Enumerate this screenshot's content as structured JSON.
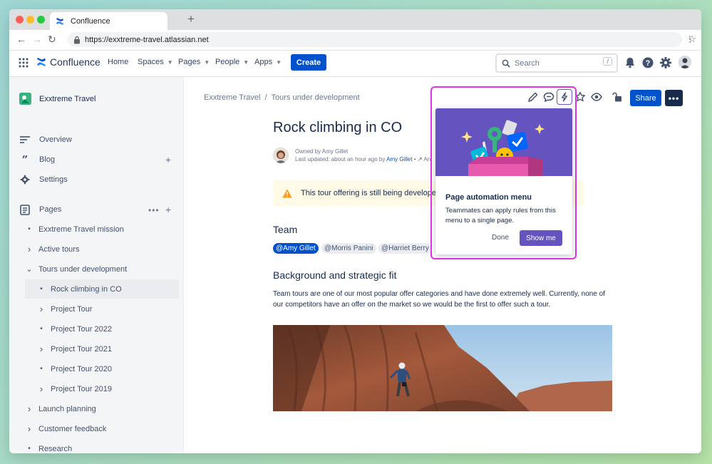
{
  "browser": {
    "tab_title": "Confluence",
    "new_tab": "+",
    "url": "https://exxtreme-travel.atlassian.net"
  },
  "topnav": {
    "product": "Confluence",
    "items": [
      "Home",
      "Spaces",
      "Pages",
      "People",
      "Apps"
    ],
    "create_label": "Create",
    "search_placeholder": "Search",
    "search_shortcut": "/"
  },
  "sidebar": {
    "space_name": "Exxtreme Travel",
    "links": [
      "Overview",
      "Blog",
      "Settings"
    ],
    "pages_label": "Pages",
    "tree": [
      {
        "label": "Exxtreme Travel mission",
        "marker": "bullet",
        "level": 0
      },
      {
        "label": "Active tours",
        "marker": "chevron-right",
        "level": 0
      },
      {
        "label": "Tours under development",
        "marker": "chevron-down",
        "level": 0
      },
      {
        "label": "Rock climbing in CO",
        "marker": "bullet",
        "level": 1,
        "selected": true
      },
      {
        "label": "Project Tour",
        "marker": "chevron-right",
        "level": 1
      },
      {
        "label": "Project Tour 2022",
        "marker": "bullet",
        "level": 1
      },
      {
        "label": "Project Tour 2021",
        "marker": "chevron-right",
        "level": 1
      },
      {
        "label": "Project Tour 2020",
        "marker": "bullet",
        "level": 1
      },
      {
        "label": "Project Tour 2019",
        "marker": "chevron-right",
        "level": 1
      },
      {
        "label": "Launch planning",
        "marker": "chevron-right",
        "level": 0
      },
      {
        "label": "Customer feedback",
        "marker": "chevron-right",
        "level": 0
      },
      {
        "label": "Research",
        "marker": "bullet",
        "level": 0
      }
    ]
  },
  "content": {
    "breadcrumb": [
      "Exxtreme Travel",
      "Tours under development"
    ],
    "breadcrumb_sep": "/",
    "share_label": "Share",
    "more_label": "•••",
    "title": "Rock climbing in CO",
    "owned_by": "Owned by Amy Gillet",
    "last_updated_prefix": "Last updated: about an hour ago by",
    "last_updated_author": "Amy Gillet",
    "last_updated_suffix": "•",
    "last_updated_tail": "An",
    "warning": "This tour offering is still being developed",
    "team_heading": "Team",
    "mentions": [
      "@Amy Gillet",
      "@Morris Panini",
      "@Harriet Berry"
    ],
    "background_heading": "Background and strategic fit",
    "background_text": "Team tours are one of our most popular offer categories and have done extremely well. Currently, none of our competitors have an offer on the market so we would be the first to offer such a tour."
  },
  "popup": {
    "title": "Page automation menu",
    "body": "Teammates can apply rules from this menu to a single page.",
    "done_label": "Done",
    "show_me_label": "Show me"
  },
  "colors": {
    "brand_blue": "#0052CC",
    "automation_purple": "#6554C0",
    "highlight_magenta": "#e033e8",
    "warning_bg": "#fffae6"
  }
}
